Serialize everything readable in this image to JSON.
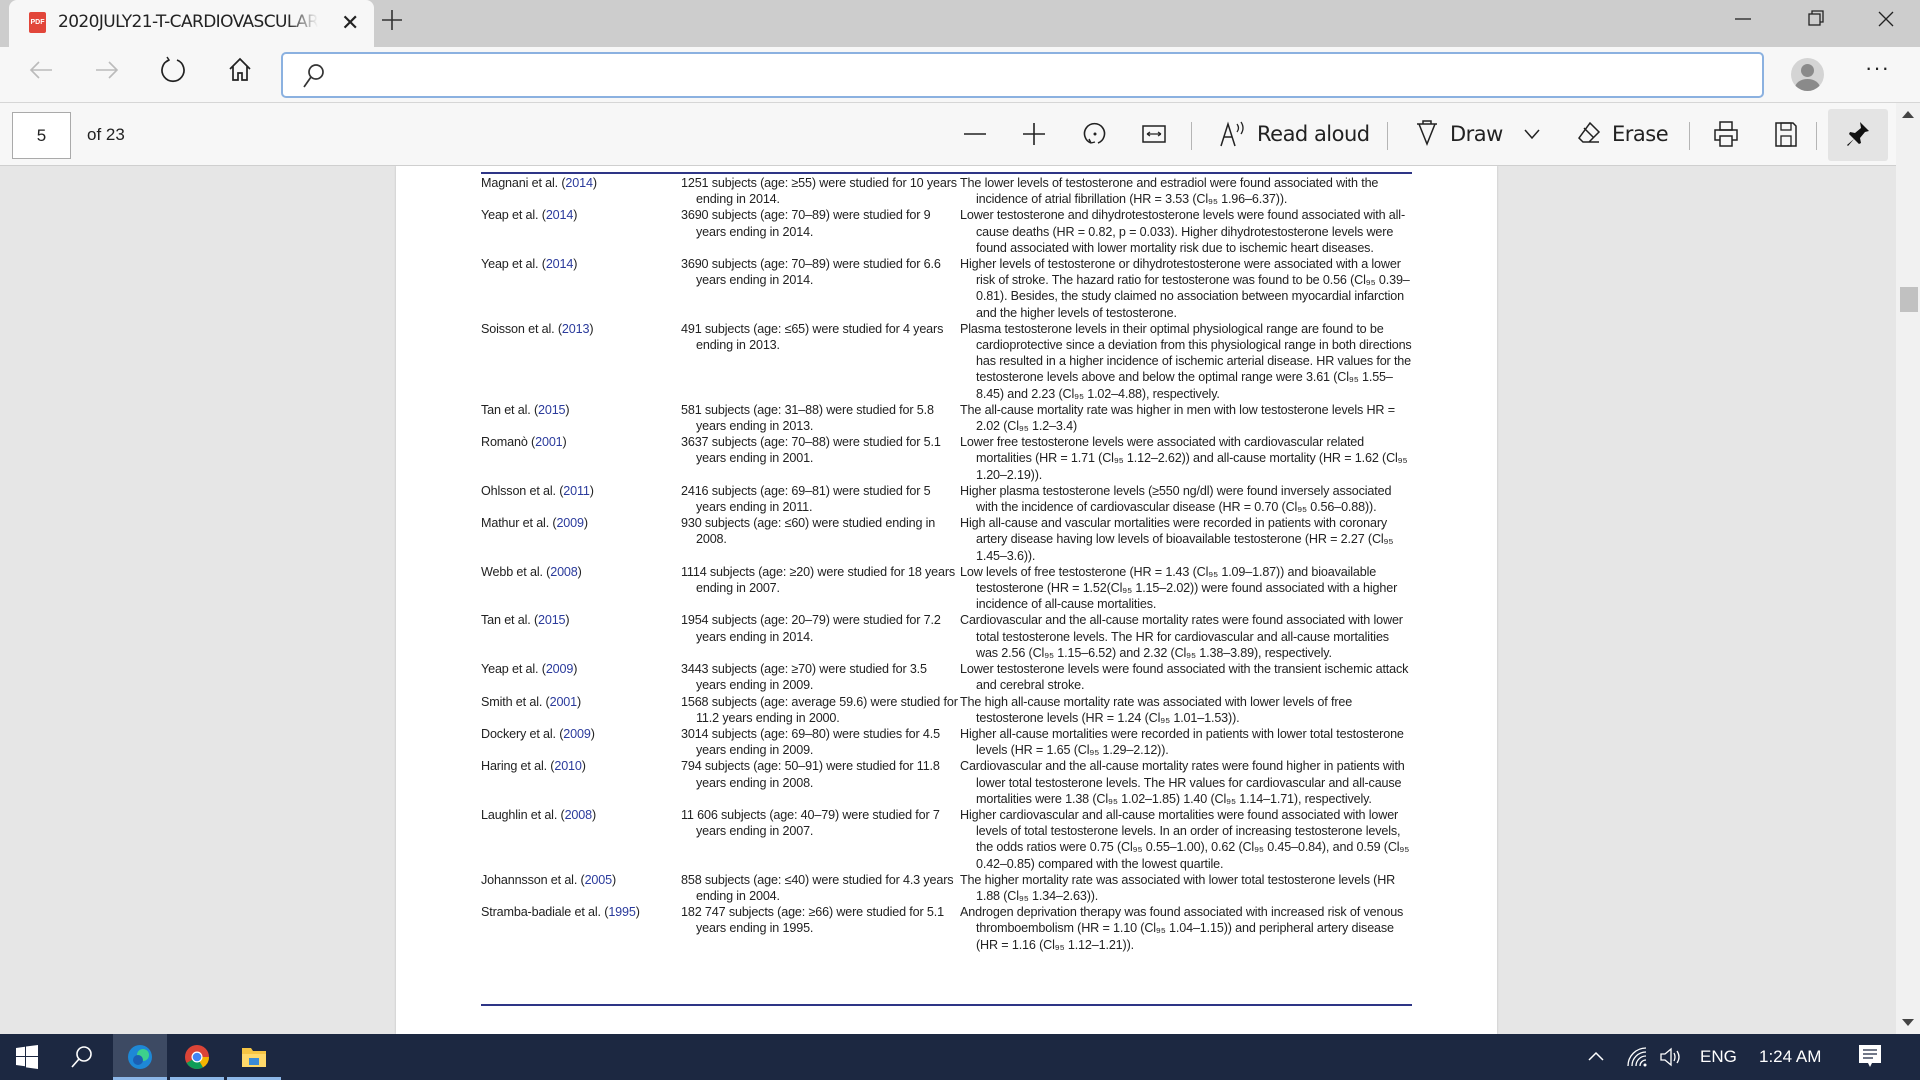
{
  "browser": {
    "tab": {
      "title": "2020JULY21-T-CARDIOVASCULAR",
      "icon": "pdf-icon",
      "icon_label": "PDF"
    },
    "new_tab_icon": "plus-icon",
    "window_controls": {
      "minimize": "—",
      "restore": "❐",
      "close": "✕"
    },
    "nav": {
      "back_icon": "←",
      "forward_icon": "→",
      "refresh_icon": "↻",
      "home_icon": "home-icon",
      "address_value": "",
      "address_placeholder": ""
    },
    "more_icon": "···"
  },
  "pdf_toolbar": {
    "current_page": "5",
    "total_pages_label": "of 23",
    "zoom_out": "—",
    "zoom_in": "+",
    "read_aloud_label": "Read aloud",
    "draw_label": "Draw",
    "erase_label": "Erase"
  },
  "table": {
    "rows": [
      {
        "author": "Magnani et al. (",
        "year": "2014",
        "study": "1251 subjects (age: ≥55) were studied for 10 years ending in 2014.",
        "findings": "The lower levels of testosterone and estradiol were found associated with the incidence of atrial fibrillation (HR = 3.53 (Cl₉₅ 1.96–6.37))."
      },
      {
        "author": "Yeap et al. (",
        "year": "2014",
        "study": "3690 subjects (age: 70–89) were studied for 9 years ending in 2014.",
        "findings": "Lower testosterone and dihydrotestosterone levels were found associated with all-cause deaths (HR = 0.82, p = 0.033). Higher dihydrotestosterone levels were found associated with lower mortality risk due to ischemic heart diseases."
      },
      {
        "author": "Yeap et al. (",
        "year": "2014",
        "study": "3690 subjects (age: 70–89) were studied for 6.6 years ending in 2014.",
        "findings": "Higher levels of testosterone or dihydrotestosterone were associated with a lower risk of stroke. The hazard ratio for testosterone was found to be 0.56 (Cl₉₅ 0.39–0.81). Besides, the study claimed no association between myocardial infarction and the higher levels of testosterone."
      },
      {
        "author": "Soisson et al. (",
        "year": "2013",
        "study": "491 subjects (age: ≤65) were studied for 4 years ending in 2013.",
        "findings": "Plasma testosterone levels in their optimal physiological range are found to be cardioprotective since a deviation from this physiological range in both directions has resulted in a higher incidence of ischemic arterial disease. HR values for the testosterone levels above and below the optimal range were 3.61 (Cl₉₅ 1.55–8.45) and 2.23 (Cl₉₅ 1.02–4.88), respectively."
      },
      {
        "author": "Tan et al. (",
        "year": "2015",
        "study": "581 subjects (age: 31–88) were studied for 5.8 years ending in 2013.",
        "findings": "The all-cause mortality rate was higher in men with low testosterone levels HR = 2.02 (Cl₉₅ 1.2–3.4)"
      },
      {
        "author": "Romanò (",
        "year": "2001",
        "study": "3637 subjects (age: 70–88) were studied for 5.1 years ending in 2001.",
        "findings": "Lower free testosterone levels were associated with cardiovascular related mortalities (HR = 1.71 (Cl₉₅ 1.12–2.62)) and all-cause mortality (HR = 1.62 (Cl₉₅ 1.20–2.19))."
      },
      {
        "author": "Ohlsson et al. (",
        "year": "2011",
        "study": "2416 subjects (age: 69–81) were studied for 5 years ending in 2011.",
        "findings": "Higher plasma testosterone levels (≥550 ng/dl) were found inversely associated with the incidence of cardiovascular disease (HR = 0.70 (Cl₉₅ 0.56–0.88))."
      },
      {
        "author": "Mathur et al. (",
        "year": "2009",
        "study": "930 subjects (age: ≤60) were studied ending in 2008.",
        "findings": "High all-cause and vascular mortalities were recorded in patients with coronary artery disease having low levels of bioavailable testosterone (HR = 2.27 (Cl₉₅ 1.45–3.6))."
      },
      {
        "author": "Webb et al. (",
        "year": "2008",
        "study": "1114 subjects (age: ≥20) were studied for 18 years ending in 2007.",
        "findings": "Low levels of free testosterone (HR = 1.43 (Cl₉₅ 1.09–1.87)) and bioavailable testosterone (HR = 1.52(Cl₉₅ 1.15–2.02)) were found associated with a higher incidence of all-cause mortalities."
      },
      {
        "author": "Tan et al. (",
        "year": "2015",
        "study": "1954 subjects (age: 20–79) were studied for 7.2 years ending in 2014.",
        "findings": "Cardiovascular and the all-cause mortality rates were found associated with lower total testosterone levels. The HR for cardiovascular and all-cause mortalities was 2.56 (Cl₉₅ 1.15–6.52) and 2.32 (Cl₉₅ 1.38–3.89), respectively."
      },
      {
        "author": "Yeap et al. (",
        "year": "2009",
        "study": "3443 subjects (age: ≥70) were studied for 3.5 years ending in 2009.",
        "findings": "Lower testosterone levels were found associated with the transient ischemic attack and cerebral stroke."
      },
      {
        "author": "Smith et al. (",
        "year": "2001",
        "study": "1568 subjects (age: average 59.6) were studied for 11.2 years ending in 2000.",
        "findings": "The high all-cause mortality rate was associated with lower levels of free testosterone levels (HR = 1.24 (Cl₉₅ 1.01–1.53))."
      },
      {
        "author": "Dockery et al. (",
        "year": "2009",
        "study": "3014 subjects (age: 69–80) were studies for 4.5 years ending in 2009.",
        "findings": "Higher all-cause mortalities were recorded in patients with lower total testosterone levels (HR = 1.65 (Cl₉₅ 1.29–2.12))."
      },
      {
        "author": "Haring et al. (",
        "year": "2010",
        "study": "794 subjects (age: 50–91) were studied for 11.8 years ending in 2008.",
        "findings": "Cardiovascular and the all-cause mortality rates were found higher in patients with lower total testosterone levels. The HR values for cardiovascular and all-cause mortalities were 1.38 (Cl₉₅ 1.02–1.85) 1.40 (Cl₉₅ 1.14–1.71), respectively."
      },
      {
        "author": "Laughlin et al. (",
        "year": "2008",
        "study": "11 606 subjects (age: 40–79) were studied for 7 years ending in 2007.",
        "findings": "Higher cardiovascular and all-cause mortalities were found associated with lower levels of total testosterone levels. In an order of increasing testosterone levels, the odds ratios were 0.75 (Cl₉₅ 0.55–1.00), 0.62 (Cl₉₅ 0.45–0.84), and 0.59 (Cl₉₅ 0.42–0.85) compared with the lowest quartile."
      },
      {
        "author": "Johannsson et al. (",
        "year": "2005",
        "study": "858 subjects (age: ≤40) were studied for 4.3 years ending in 2004.",
        "findings": "The higher mortality rate was associated with lower total testosterone levels (HR 1.88 (Cl₉₅ 1.34–2.63))."
      },
      {
        "author": "Stramba-badiale et al. (",
        "year": "1995",
        "study": "182 747 subjects (age: ≥66) were studied for 5.1 years ending in 1995.",
        "findings": "Androgen deprivation therapy was found associated with increased risk of venous thromboembolism (HR = 1.10 (Cl₉₅ 1.04–1.15)) and peripheral artery disease (HR = 1.16 (Cl₉₅ 1.12–1.21))."
      }
    ]
  },
  "taskbar": {
    "tray": {
      "language": "ENG",
      "time": "1:24 AM"
    }
  },
  "colors": {
    "link_year": "#2b3b9c",
    "table_rule": "#2e3586",
    "taskbar_bg": "#1c2841",
    "address_focus": "#8bb1e0"
  }
}
